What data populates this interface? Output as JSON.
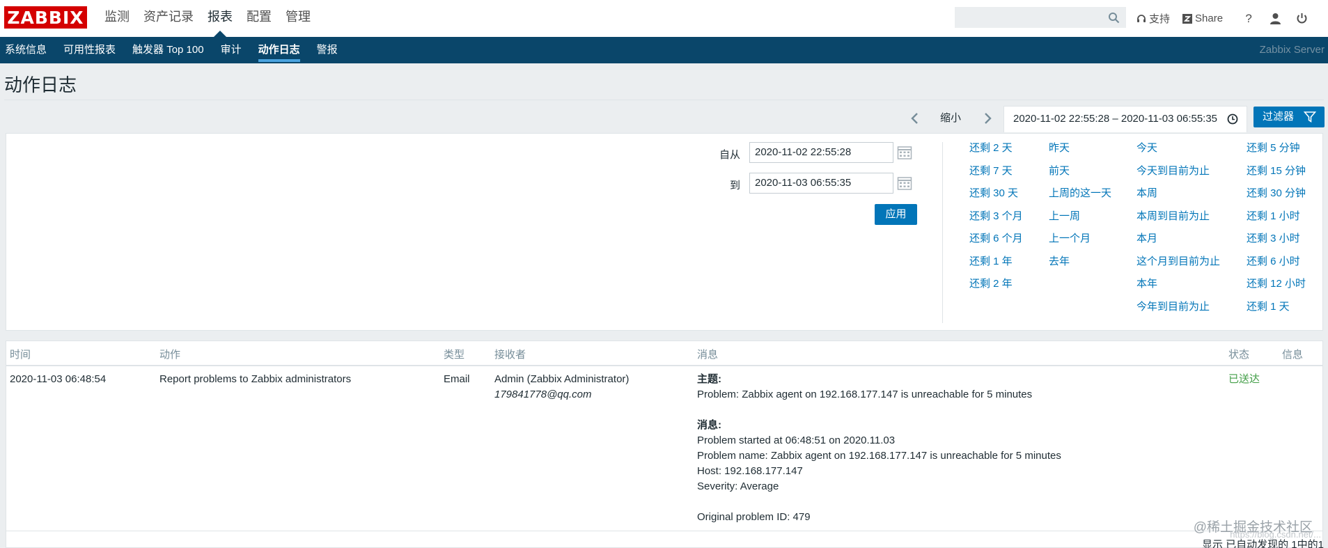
{
  "header": {
    "logo": "ZABBIX",
    "menu": [
      "监测",
      "资产记录",
      "报表",
      "配置",
      "管理"
    ],
    "active_menu_index": 2,
    "search_placeholder": "",
    "support_label": "支持",
    "share_label": "Share",
    "help_label": "?"
  },
  "subnav": {
    "items": [
      "系统信息",
      "可用性报表",
      "触发器 Top 100",
      "审计",
      "动作日志",
      "警报"
    ],
    "active_index": 4,
    "server_name": "Zabbix Server"
  },
  "page": {
    "title": "动作日志"
  },
  "timenav": {
    "zoom_label": "缩小",
    "range_label": "2020-11-02 22:55:28 – 2020-11-03 06:55:35",
    "filter_button": "过滤器"
  },
  "filter": {
    "from_label": "自从",
    "from_value": "2020-11-02 22:55:28",
    "to_label": "到",
    "to_value": "2020-11-03 06:55:35",
    "apply_label": "应用",
    "quick_columns": [
      [
        "还剩 2 天",
        "还剩 7 天",
        "还剩 30 天",
        "还剩 3 个月",
        "还剩 6 个月",
        "还剩 1 年",
        "还剩 2 年"
      ],
      [
        "昨天",
        "前天",
        "上周的这一天",
        "上一周",
        "上一个月",
        "去年"
      ],
      [
        "今天",
        "今天到目前为止",
        "本周",
        "本周到目前为止",
        "本月",
        "这个月到目前为止",
        "本年",
        "今年到目前为止"
      ],
      [
        "还剩 5 分钟",
        "还剩 15 分钟",
        "还剩 30 分钟",
        "还剩 1 小时",
        "还剩 3 小时",
        "还剩 6 小时",
        "还剩 12 小时",
        "还剩 1 天"
      ]
    ]
  },
  "table": {
    "columns": [
      "时间",
      "动作",
      "类型",
      "接收者",
      "消息",
      "状态",
      "信息"
    ],
    "row": {
      "time": "2020-11-03 06:48:54",
      "action": "Report problems to Zabbix administrators",
      "type": "Email",
      "recipient_name": "Admin (Zabbix Administrator)",
      "recipient_email": "179841778@qq.com",
      "subject_label": "主题:",
      "subject": "Problem: Zabbix agent on 192.168.177.147 is unreachable for 5 minutes",
      "message_label": "消息:",
      "message_lines": [
        "Problem started at 06:48:51 on 2020.11.03",
        "Problem name: Zabbix agent on 192.168.177.147 is unreachable for 5 minutes",
        "Host: 192.168.177.147",
        "Severity: Average",
        "",
        "Original problem ID: 479"
      ],
      "status": "已送达"
    }
  },
  "footer": {
    "text": "显示 已自动发现的 1中的1"
  },
  "watermark": "@稀土掘金技术社区",
  "watermark_url": "https://blog.csdn.net/..."
}
